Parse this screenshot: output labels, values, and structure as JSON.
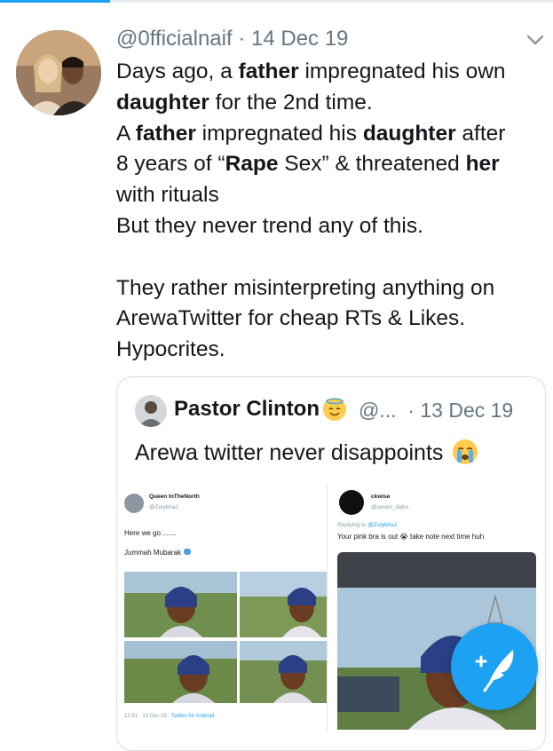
{
  "tweet": {
    "handle": "@0fficialnaif",
    "separator": "·",
    "date": "14 Dec 19",
    "lines": [
      [
        {
          "t": "Days ago, a "
        },
        {
          "t": "father",
          "b": true
        },
        {
          "t": " impregnated his own"
        }
      ],
      [
        {
          "t": "daughter",
          "b": true
        },
        {
          "t": " for the 2nd time."
        }
      ],
      [
        {
          "t": "A "
        },
        {
          "t": "father",
          "b": true
        },
        {
          "t": " impregnated his "
        },
        {
          "t": "daughter",
          "b": true
        },
        {
          "t": " after"
        }
      ],
      [
        {
          "t": "8 years of “"
        },
        {
          "t": "Rape",
          "b": true
        },
        {
          "t": " Sex” & threatened "
        },
        {
          "t": "her",
          "b": true
        }
      ],
      [
        {
          "t": "with rituals"
        }
      ],
      [
        {
          "t": "But they never trend any of this."
        }
      ],
      [],
      [
        {
          "t": "They rather misinterpreting anything on"
        }
      ],
      [
        {
          "t": "ArewaTwitter for cheap RTs & Likes."
        }
      ],
      [
        {
          "t": "Hypocrites."
        }
      ]
    ]
  },
  "quoted": {
    "name": "Pastor Clinton",
    "handle": "@...",
    "separator": "·",
    "date": "13 Dec 19",
    "text": "Arewa twitter never disappoints",
    "left_screenshot": {
      "name": "Queen InTheNorth",
      "handle": "@ZulykhaJ",
      "line1": "Here we go........",
      "line2": "Jummah Mubarak",
      "footer_time": "12:51 · 13 Dec 19 · ",
      "footer_client": "Twitter for Android"
    },
    "right_screenshot": {
      "name": "ckwise",
      "handle": "@seven_dabo",
      "replying_prefix": "Replying to ",
      "replying_handle": "@ZulykhaJ",
      "text": "Your pink bra is out 😭 take note next time huh"
    }
  },
  "icons": {
    "chevron": "chevron-down-icon",
    "compose": "compose-tweet-icon"
  },
  "colors": {
    "accent": "#1da1f2",
    "muted": "#657786",
    "text": "#14171a"
  }
}
